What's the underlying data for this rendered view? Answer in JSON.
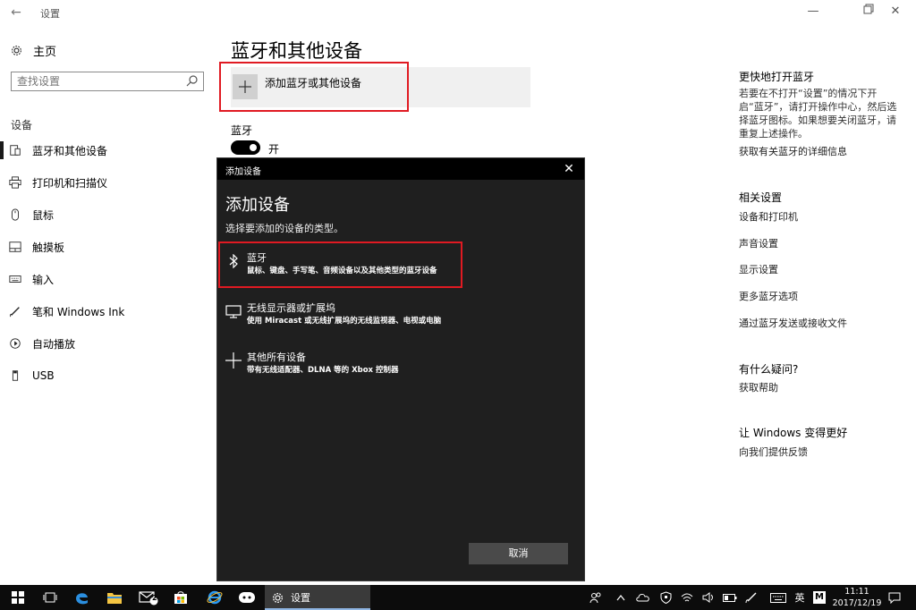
{
  "window": {
    "title": "设置"
  },
  "sidebar": {
    "home_label": "主页",
    "search_placeholder": "查找设置",
    "section_label": "设备",
    "items": [
      {
        "label": "蓝牙和其他设备",
        "icon": "bluetooth-devices-icon",
        "active": true
      },
      {
        "label": "打印机和扫描仪",
        "icon": "printer-icon",
        "active": false
      },
      {
        "label": "鼠标",
        "icon": "mouse-icon",
        "active": false
      },
      {
        "label": "触摸板",
        "icon": "touchpad-icon",
        "active": false
      },
      {
        "label": "输入",
        "icon": "keyboard-icon",
        "active": false
      },
      {
        "label": "笔和 Windows Ink",
        "icon": "pen-icon",
        "active": false
      },
      {
        "label": "自动播放",
        "icon": "autoplay-icon",
        "active": false
      },
      {
        "label": "USB",
        "icon": "usb-icon",
        "active": false
      }
    ]
  },
  "main": {
    "page_title": "蓝牙和其他设备",
    "add_device_label": "添加蓝牙或其他设备",
    "bluetooth_heading": "蓝牙",
    "bluetooth_state": "开"
  },
  "right": {
    "quick_heading": "更快地打开蓝牙",
    "quick_text": "若要在不打开“设置”的情况下开启“蓝牙”，请打开操作中心，然后选择蓝牙图标。如果想要关闭蓝牙，请重复上述操作。",
    "quick_link": "获取有关蓝牙的详细信息",
    "related_heading": "相关设置",
    "related_links": [
      "设备和打印机",
      "声音设置",
      "显示设置",
      "更多蓝牙选项",
      "通过蓝牙发送或接收文件"
    ],
    "question_heading": "有什么疑问?",
    "help_link": "获取帮助",
    "improve_heading": "让 Windows 变得更好",
    "feedback_link": "向我们提供反馈"
  },
  "dialog": {
    "title": "添加设备",
    "heading": "添加设备",
    "subtitle": "选择要添加的设备的类型。",
    "options": [
      {
        "title": "蓝牙",
        "desc": "鼠标、键盘、手写笔、音频设备以及其他类型的蓝牙设备",
        "icon": "bluetooth-icon"
      },
      {
        "title": "无线显示器或扩展坞",
        "desc": "使用 Miracast 或无线扩展坞的无线监视器、电视或电脑",
        "icon": "monitor-icon"
      },
      {
        "title": "其他所有设备",
        "desc": "带有无线适配器、DLNA 等的 Xbox 控制器",
        "icon": "plus-icon"
      }
    ],
    "cancel_label": "取消"
  },
  "taskbar": {
    "settings_label": "设置",
    "mail_badge": "2",
    "ime_label": "英",
    "ime_mode": "M",
    "time": "11:11",
    "date": "2017/12/19"
  },
  "colors": {
    "highlight": "#e01a22",
    "dialog_bg": "#1f1f1f",
    "taskbar_bg": "#0c0c0c"
  }
}
